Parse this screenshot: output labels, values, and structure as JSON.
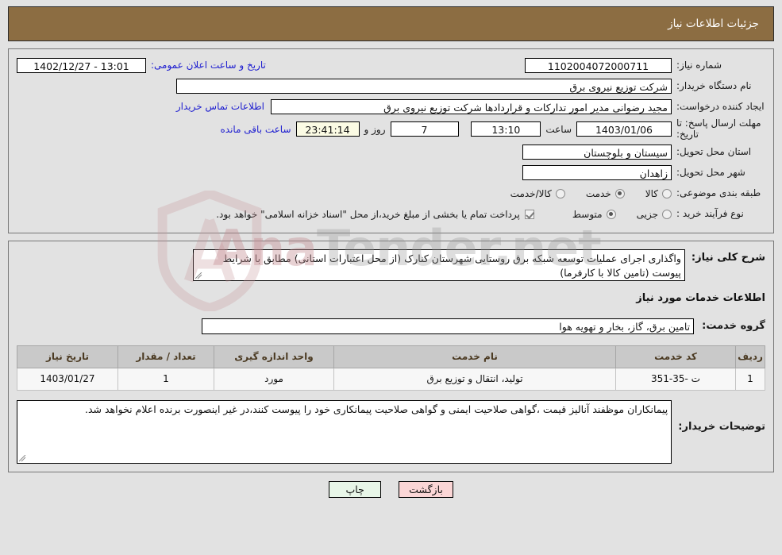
{
  "header": {
    "title": "جزئیات اطلاعات نیاز"
  },
  "form": {
    "need_number_label": "شماره نیاز:",
    "need_number_value": "1102004072000711",
    "public_announce_label": "تاریخ و ساعت اعلان عمومی:",
    "public_announce_value": "1402/12/27 - 13:01",
    "buyer_org_label": "نام دستگاه خریدار:",
    "buyer_org_value": "شرکت توزیع نیروی برق",
    "creator_label": "ایجاد کننده درخواست:",
    "creator_value": "مجید  رضوانی مدیر امور تدارکات و قراردادها شرکت توزیع نیروی برق",
    "buyer_contact_link": "اطلاعات تماس خریدار",
    "deadline_label": "مهلت ارسال پاسخ: تا تاریخ:",
    "deadline_date": "1403/01/06",
    "deadline_hour_label": "ساعت",
    "deadline_time": "13:10",
    "remaining_days": "7",
    "days_and_label": "روز و",
    "remaining_time": "23:41:14",
    "remaining_suffix_label": "ساعت باقی مانده",
    "province_label": "استان محل تحویل:",
    "province_value": "سیستان و بلوچستان",
    "city_label": "شهر محل تحویل:",
    "city_value": "زاهدان",
    "category_label": "طبقه بندی موضوعی:",
    "category_options": [
      {
        "label": "کالا",
        "selected": false
      },
      {
        "label": "خدمت",
        "selected": true
      },
      {
        "label": "کالا/خدمت",
        "selected": false
      }
    ],
    "process_label": "نوع فرآیند خرید :",
    "process_options": [
      {
        "label": "جزیی",
        "selected": false
      },
      {
        "label": "متوسط",
        "selected": true
      }
    ],
    "treasury_checkbox_checked": true,
    "treasury_checkbox_text": "پرداخت تمام یا بخشی از مبلغ خرید،از محل \"اسناد خزانه اسلامی\" خواهد بود."
  },
  "description": {
    "label": "شرح کلی نیاز:",
    "value": "واگذاری اجرای عملیات توسعه شبکه برق روستایی شهرستان کنارک (از محل اعتبارات استانی) مطابق با شرایط پیوست (تامین کالا با کارفرما)"
  },
  "services_section": {
    "title": "اطلاعات خدمات مورد نیاز",
    "group_label": "گروه خدمت:",
    "group_value": "تامین برق، گاز، بخار و تهویه هوا"
  },
  "table": {
    "headers": [
      "ردیف",
      "کد خدمت",
      "نام خدمت",
      "واحد اندازه گیری",
      "تعداد / مقدار",
      "تاریخ نیاز"
    ],
    "rows": [
      {
        "index": "1",
        "code": "ت -35-351",
        "name": "تولید، انتقال و توزیع برق",
        "unit": "مورد",
        "qty": "1",
        "date": "1403/01/27"
      }
    ]
  },
  "notes": {
    "label": "توضیحات خریدار:",
    "value": "پیمانکاران موظفند آنالیز قیمت ،گواهی صلاحیت ایمنی و گواهی صلاحیت پیمانکاری خود را پیوست کنند،در غیر اینصورت برنده اعلام نخواهد شد."
  },
  "footer": {
    "print_label": "چاپ",
    "back_label": "بازگشت"
  },
  "watermark": {
    "text_part1": "Ana",
    "text_part2": "Tender",
    "text_part3": ".net"
  },
  "colors": {
    "header_bg": "#8c6d42",
    "page_bg": "#e2e2e2",
    "link": "#1d1dd0",
    "table_header_bg": "#c9c9c9",
    "print_btn_bg": "#e8f6e8",
    "back_btn_bg": "#fbd6d6"
  }
}
